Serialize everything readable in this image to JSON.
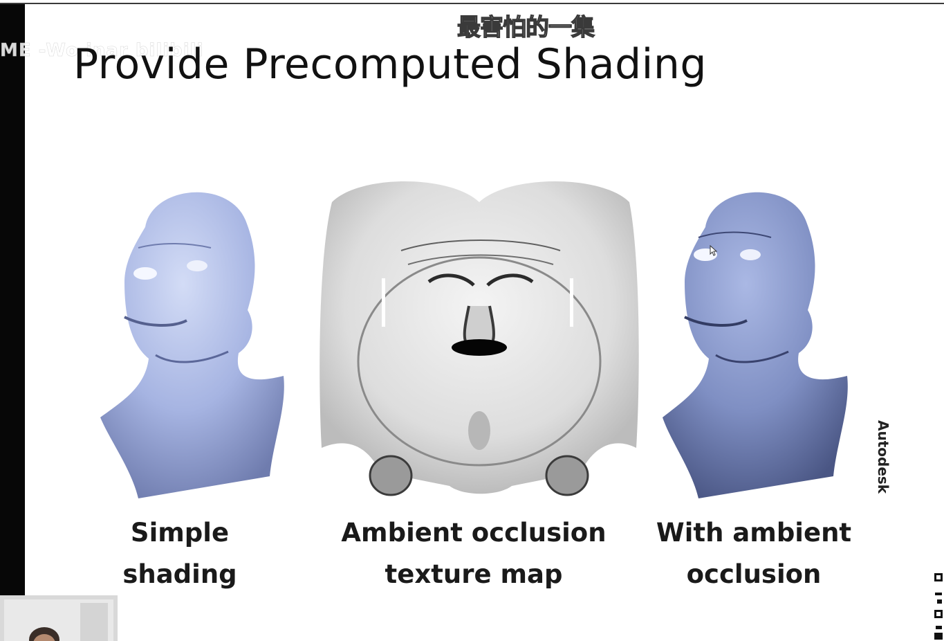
{
  "overlay": {
    "watermark_text": "ME -Wo inar bilibili",
    "subtitle": "最害怕的一集"
  },
  "slide": {
    "title": "Provide Precomputed Shading",
    "figures": [
      {
        "caption_line1": "Simple",
        "caption_line2": "shading",
        "icon": "head-render-icon"
      },
      {
        "caption_line1": "Ambient occlusion",
        "caption_line2": "texture map",
        "icon": "texture-map-icon"
      },
      {
        "caption_line1": "With ambient",
        "caption_line2": "occlusion",
        "icon": "head-render-icon"
      }
    ],
    "credit": "Autodesk"
  },
  "colors": {
    "head_light": "#c3cff0",
    "head_mid": "#8fa0d6",
    "head_dark": "#4f5b86",
    "texture_light": "#efefef",
    "texture_dark": "#2b2b2b"
  }
}
